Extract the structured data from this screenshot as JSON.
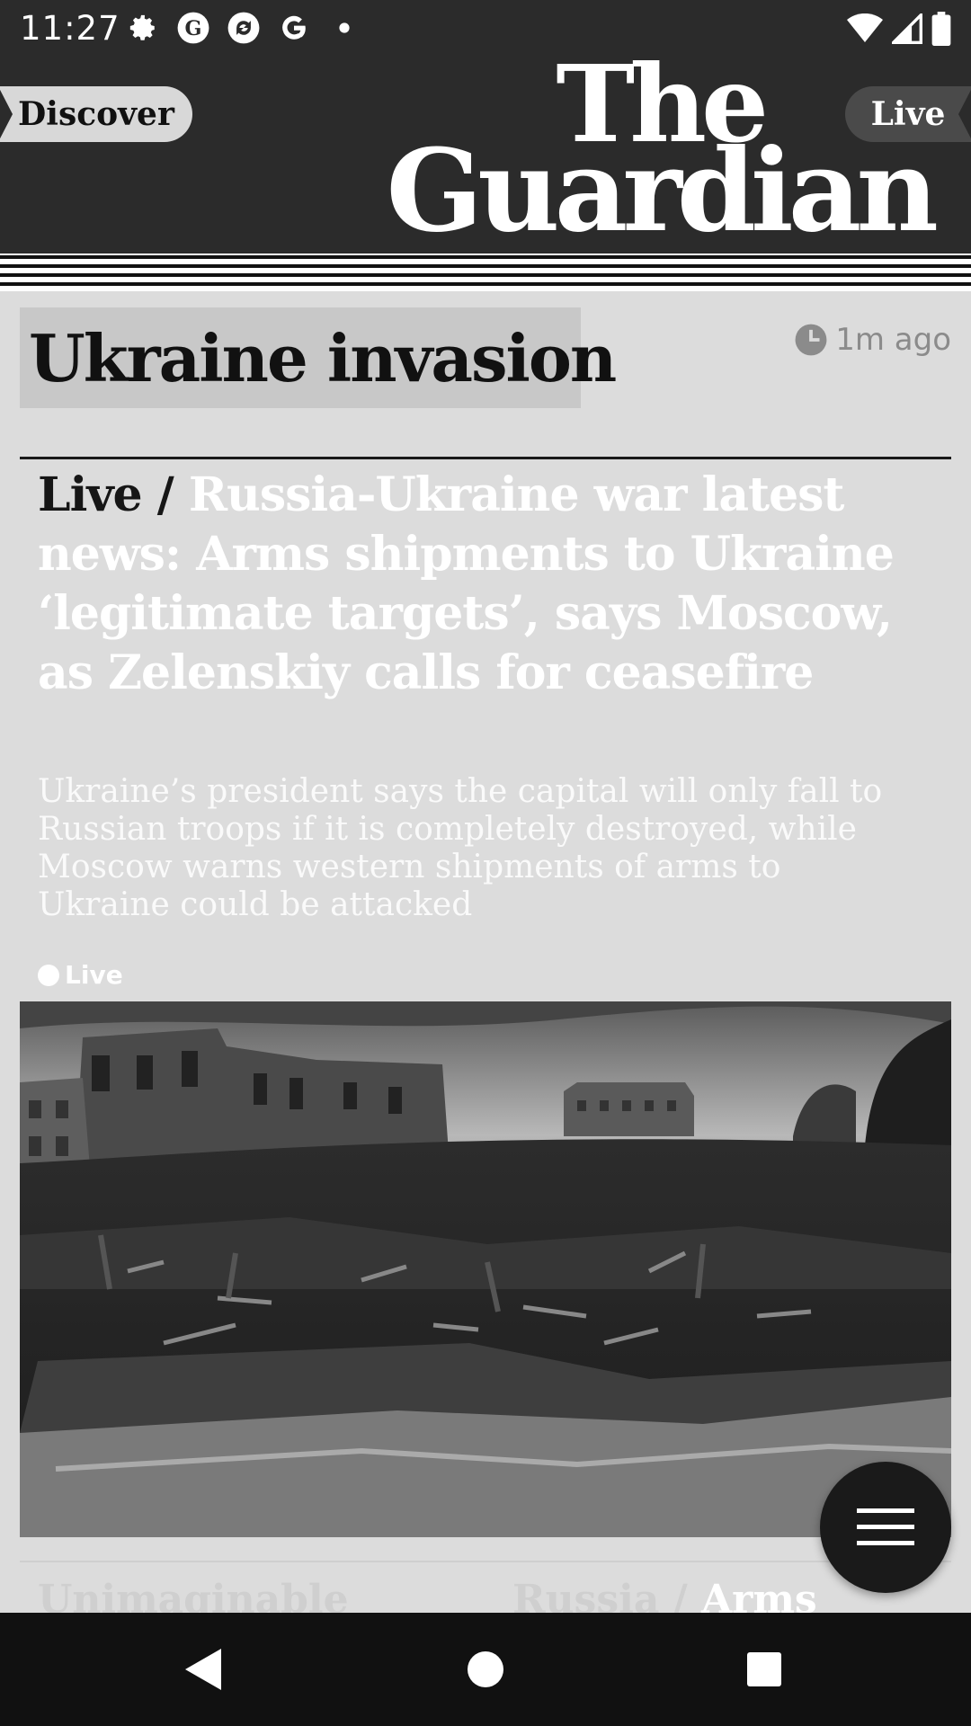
{
  "status_bar": {
    "time": "11:27",
    "left_icons": [
      "gear-icon",
      "app-icon-g-circle",
      "sync-icon",
      "google-icon",
      "dot-icon"
    ],
    "right_icons": [
      "wifi-icon",
      "signal-icon",
      "battery-icon"
    ]
  },
  "header": {
    "discover_label": "Discover",
    "live_label": "Live",
    "logo_line1": "The",
    "logo_line2": "Guardian"
  },
  "section": {
    "tag": "Ukraine invasion",
    "timestamp": "1m ago"
  },
  "article": {
    "kicker": "Live /",
    "headline": "Russia-Ukraine war latest news: Arms shipments to Ukraine ‘legitimate targets’, says Moscow, as Zelenskiy calls for ceasefire",
    "standfirst": "Ukraine’s president says the capital will only fall to Russian troops if it is completely destroyed, while Moscow warns western shipments of arms to Ukraine could be attacked",
    "live_badge": "Live"
  },
  "next_cards": {
    "left": "Unimaginable",
    "right_kicker": "Russia /",
    "right_headline": "Arms"
  },
  "colors": {
    "background": "#dcdcdc",
    "header": "#2b2b2b",
    "navbar": "#111111"
  }
}
